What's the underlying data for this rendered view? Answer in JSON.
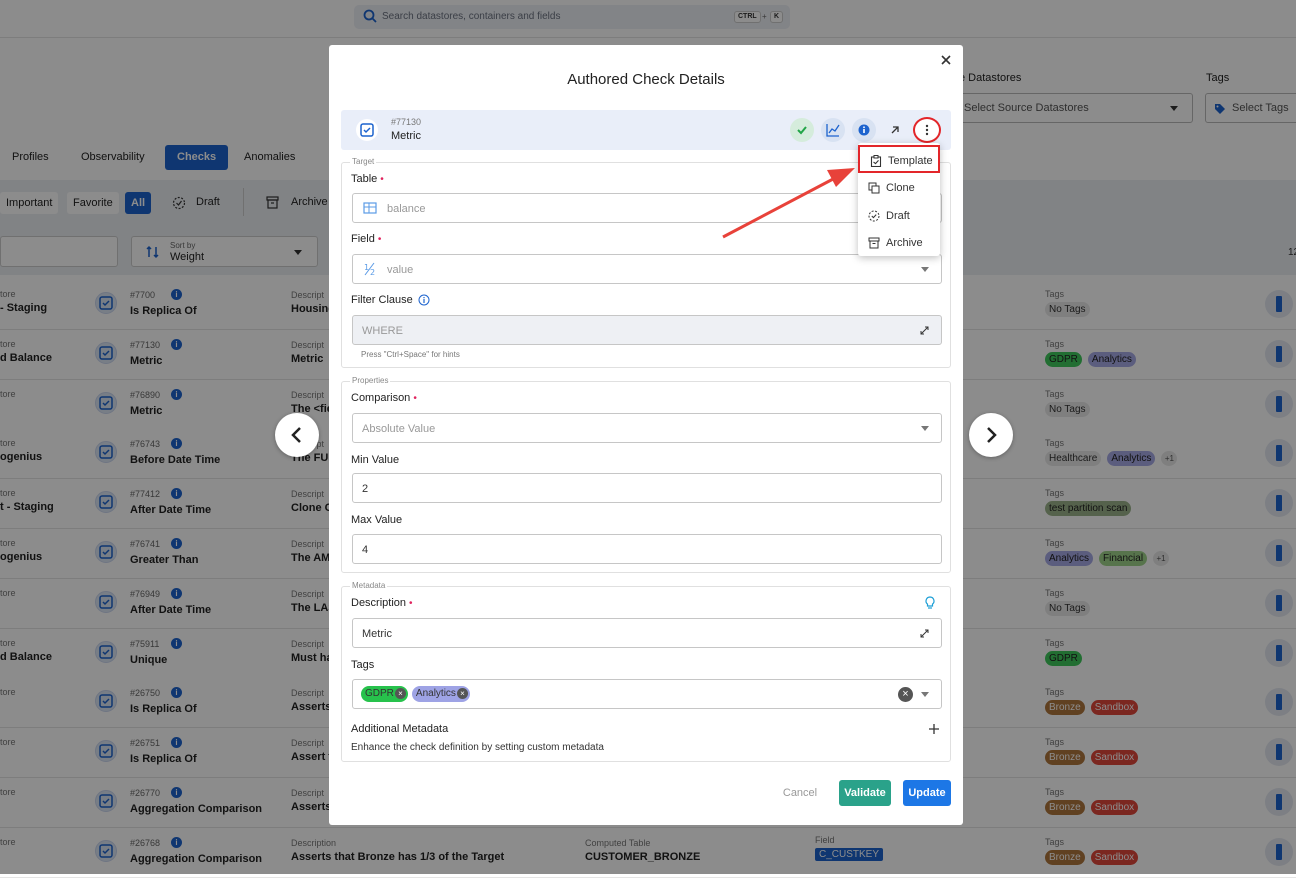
{
  "topbar": {
    "search_placeholder": "Search datastores, containers and fields",
    "kbd1": "CTRL",
    "kbd_plus": "+",
    "kbd2": "K"
  },
  "filters": {
    "source_label": "e Datastores",
    "source_placeholder": "Select Source Datastores",
    "tags_label": "Tags",
    "tags_placeholder": "Select Tags"
  },
  "tabs": [
    "Profiles",
    "Observability",
    "Checks",
    "Anomalies"
  ],
  "chips": {
    "important": "Important",
    "favorite": "Favorite",
    "all": "All",
    "draft": "Draft",
    "archive": "Archive"
  },
  "sort": {
    "label": "Sort by",
    "value": "Weight"
  },
  "count_fragment": "12",
  "rows": [
    {
      "ds1": "tore",
      "ds2": "- Staging",
      "id": "#7700",
      "type": "Is Replica Of",
      "dl": "Descript",
      "dt": "Housing",
      "tl": "Tags",
      "tags": [
        [
          "notag",
          "No Tags"
        ]
      ]
    },
    {
      "ds1": "tore",
      "ds2": "d Balance",
      "id": "#77130",
      "type": "Metric",
      "dl": "Descript",
      "dt": "Metric",
      "tl": "Tags",
      "tags": [
        [
          "gdpr",
          "GDPR"
        ],
        [
          "analytics",
          "Analytics"
        ]
      ]
    },
    {
      "ds1": "tore",
      "ds2": "",
      "id": "#76890",
      "type": "Metric",
      "dl": "Descript",
      "dt": "The <fie",
      "tl": "Tags",
      "tags": [
        [
          "notag",
          "No Tags"
        ]
      ]
    },
    {
      "ds1": "tore",
      "ds2": "ogenius",
      "id": "#76743",
      "type": "Before Date Time",
      "dl": "Descript",
      "dt": "The FUN",
      "tl": "Tags",
      "tags": [
        [
          "health",
          "Healthcare"
        ],
        [
          "analytics",
          "Analytics"
        ],
        [
          "plus",
          "+1"
        ]
      ]
    },
    {
      "ds1": "tore",
      "ds2": "t - Staging",
      "id": "#77412",
      "type": "After Date Time",
      "dl": "Descript",
      "dt": "Clone C",
      "tl": "Tags",
      "tags": [
        [
          "tps",
          "test partition scan"
        ]
      ]
    },
    {
      "ds1": "tore",
      "ds2": "ogenius",
      "id": "#76741",
      "type": "Greater Than",
      "dl": "Descript",
      "dt": "The AM",
      "tl": "Tags",
      "tags": [
        [
          "analytics",
          "Analytics"
        ],
        [
          "fin",
          "Financial"
        ],
        [
          "plus",
          "+1"
        ]
      ]
    },
    {
      "ds1": "tore",
      "ds2": "",
      "id": "#76949",
      "type": "After Date Time",
      "dl": "Descript",
      "dt": "The LAS",
      "tl": "Tags",
      "tags": [
        [
          "notag",
          "No Tags"
        ]
      ]
    },
    {
      "ds1": "tore",
      "ds2": "d Balance",
      "id": "#75911",
      "type": "Unique",
      "dl": "Descript",
      "dt": "Must ha",
      "tl": "Tags",
      "tags": [
        [
          "gdpr",
          "GDPR"
        ]
      ]
    },
    {
      "ds1": "tore",
      "ds2": "",
      "id": "#26750",
      "type": "Is Replica Of",
      "dl": "Descript",
      "dt": "Asserts",
      "tl": "Tags",
      "tags": [
        [
          "bronze",
          "Bronze"
        ],
        [
          "sandbox",
          "Sandbox"
        ]
      ]
    },
    {
      "ds1": "tore",
      "ds2": "",
      "id": "#26751",
      "type": "Is Replica Of",
      "dl": "Descript",
      "dt": "Assert t",
      "tl": "Tags",
      "tags": [
        [
          "bronze",
          "Bronze"
        ],
        [
          "sandbox",
          "Sandbox"
        ]
      ]
    },
    {
      "ds1": "tore",
      "ds2": "",
      "id": "#26770",
      "type": "Aggregation Comparison",
      "dl": "Descript",
      "dt": "Asserts",
      "tl": "Tags",
      "tags": [
        [
          "bronze",
          "Bronze"
        ],
        [
          "sandbox",
          "Sandbox"
        ]
      ]
    },
    {
      "ds1": "tore",
      "ds2": "",
      "id": "#26768",
      "type": "Aggregation Comparison",
      "dl": "Description",
      "dt": "Asserts that Bronze has 1/3 of the Target",
      "tl": "Tags",
      "tags": [
        [
          "bronze",
          "Bronze"
        ],
        [
          "sandbox",
          "Sandbox"
        ]
      ],
      "ctl": "Computed Table",
      "ctv": "CUSTOMER_BRONZE",
      "fl": "Field",
      "fv": "C_CUSTKEY"
    }
  ],
  "modal": {
    "title": "Authored Check Details",
    "check_id": "#77130",
    "check_name": "Metric",
    "target_legend": "Target",
    "table_label": "Table",
    "table_value": "balance",
    "field_label": "Field",
    "field_value": "value",
    "filter_label": "Filter Clause",
    "filter_placeholder": "WHERE",
    "filter_hint": "Press \"Ctrl+Space\" for hints",
    "properties_legend": "Properties",
    "comparison_label": "Comparison",
    "comparison_value": "Absolute Value",
    "min_label": "Min Value",
    "min_value": "2",
    "max_label": "Max Value",
    "max_value": "4",
    "metadata_legend": "Metadata",
    "description_label": "Description",
    "description_value": "Metric",
    "tags_label": "Tags",
    "tag1": "GDPR",
    "tag2": "Analytics",
    "additional_label": "Additional Metadata",
    "additional_hint": "Enhance the check definition by setting custom metadata",
    "cancel": "Cancel",
    "validate": "Validate",
    "update": "Update",
    "required_mark": "•"
  },
  "menu": {
    "template": "Template",
    "clone": "Clone",
    "draft": "Draft",
    "archive": "Archive"
  },
  "colors": {
    "primary": "#1d63ce",
    "validate": "#2aa28a",
    "highlight": "#e3262a"
  }
}
